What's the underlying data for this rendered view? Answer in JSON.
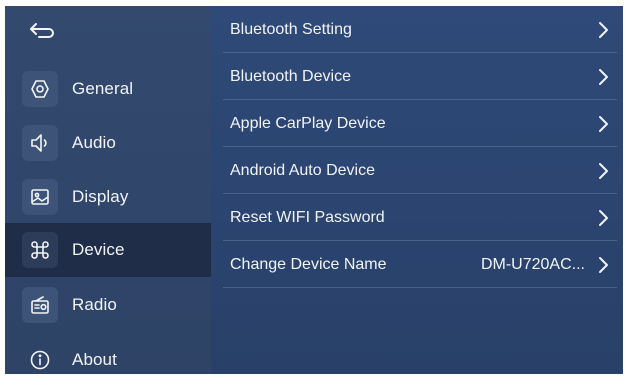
{
  "sidebar": {
    "back_icon": "back-arrow-icon",
    "items": [
      {
        "label": "General",
        "icon": "gear-hexagon-icon",
        "active": false
      },
      {
        "label": "Audio",
        "icon": "speaker-icon",
        "active": false
      },
      {
        "label": "Display",
        "icon": "image-icon",
        "active": false
      },
      {
        "label": "Device",
        "icon": "command-key-icon",
        "active": true
      },
      {
        "label": "Radio",
        "icon": "radio-icon",
        "active": false
      },
      {
        "label": "About",
        "icon": "info-icon",
        "active": false
      }
    ]
  },
  "device_menu": {
    "rows": [
      {
        "label": "Bluetooth Setting",
        "value": ""
      },
      {
        "label": "Bluetooth Device",
        "value": ""
      },
      {
        "label": "Apple CarPlay Device",
        "value": ""
      },
      {
        "label": "Android Auto Device",
        "value": ""
      },
      {
        "label": "Reset WIFI Password",
        "value": ""
      },
      {
        "label": "Change Device Name",
        "value": "DM-U720AC..."
      }
    ]
  },
  "colors": {
    "background": "#2c4570",
    "sidebar": "#30466a",
    "active_item": "#1f2d48",
    "text": "#f1f4f8"
  }
}
